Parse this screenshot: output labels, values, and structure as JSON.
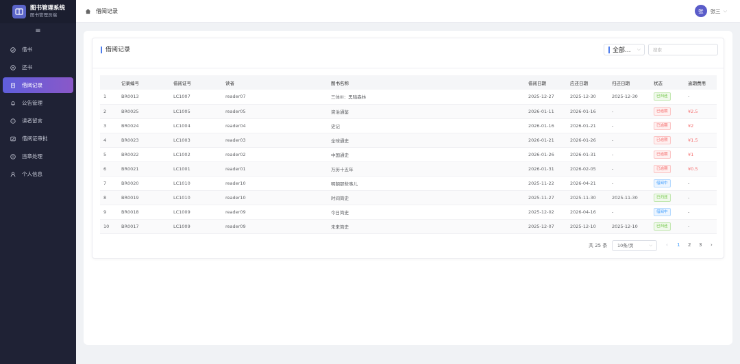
{
  "app": {
    "title": "图书管理系统",
    "subtitle": "图书管理员端"
  },
  "sidebar": {
    "items": [
      {
        "label": "借书",
        "icon": "check-circle-icon"
      },
      {
        "label": "还书",
        "icon": "return-icon"
      },
      {
        "label": "借阅记录",
        "icon": "document-icon",
        "active": true
      },
      {
        "label": "公告管理",
        "icon": "bell-icon"
      },
      {
        "label": "读者留言",
        "icon": "chat-icon"
      },
      {
        "label": "借阅证审批",
        "icon": "approval-icon"
      },
      {
        "label": "违章处理",
        "icon": "warning-icon"
      },
      {
        "label": "个人信息",
        "icon": "user-icon"
      }
    ]
  },
  "header": {
    "breadcrumb": "借阅记录"
  },
  "user": {
    "avatar_char": "张",
    "name": "张三"
  },
  "card": {
    "title": "借阅记录",
    "filter_value": "全部...",
    "search_placeholder": "搜索"
  },
  "table": {
    "columns": [
      "",
      "记录编号",
      "借阅证号",
      "读者",
      "图书名称",
      "借阅日期",
      "应还日期",
      "归还日期",
      "状态",
      "逾期费用"
    ],
    "rows": [
      {
        "idx": "1",
        "record": "BR0013",
        "card": "LC1007",
        "reader": "reader07",
        "book": "三体III：黑暗森林",
        "borrow": "2025-12-27",
        "due": "2025-12-30",
        "returned": "2025-12-30",
        "status": "已归还",
        "status_type": "returned",
        "fee": "-"
      },
      {
        "idx": "2",
        "record": "BR0025",
        "card": "LC1005",
        "reader": "reader05",
        "book": "资治通鉴",
        "borrow": "2026-01-11",
        "due": "2026-01-16",
        "returned": "-",
        "status": "已逾期",
        "status_type": "overdue",
        "fee": "¥2.5"
      },
      {
        "idx": "3",
        "record": "BR0024",
        "card": "LC1004",
        "reader": "reader04",
        "book": "史记",
        "borrow": "2026-01-16",
        "due": "2026-01-21",
        "returned": "-",
        "status": "已逾期",
        "status_type": "overdue",
        "fee": "¥2"
      },
      {
        "idx": "4",
        "record": "BR0023",
        "card": "LC1003",
        "reader": "reader03",
        "book": "全球通史",
        "borrow": "2026-01-21",
        "due": "2026-01-26",
        "returned": "-",
        "status": "已逾期",
        "status_type": "overdue",
        "fee": "¥1.5"
      },
      {
        "idx": "5",
        "record": "BR0022",
        "card": "LC1002",
        "reader": "reader02",
        "book": "中国通史",
        "borrow": "2026-01-26",
        "due": "2026-01-31",
        "returned": "-",
        "status": "已逾期",
        "status_type": "overdue",
        "fee": "¥1"
      },
      {
        "idx": "6",
        "record": "BR0021",
        "card": "LC1001",
        "reader": "reader01",
        "book": "万历十五年",
        "borrow": "2026-01-31",
        "due": "2026-02-05",
        "returned": "-",
        "status": "已逾期",
        "status_type": "overdue",
        "fee": "¥0.5"
      },
      {
        "idx": "7",
        "record": "BR0020",
        "card": "LC1010",
        "reader": "reader10",
        "book": "明朝那些事儿",
        "borrow": "2025-11-22",
        "due": "2026-04-21",
        "returned": "-",
        "status": "借阅中",
        "status_type": "borrowing",
        "fee": "-"
      },
      {
        "idx": "8",
        "record": "BR0019",
        "card": "LC1010",
        "reader": "reader10",
        "book": "时间简史",
        "borrow": "2025-11-27",
        "due": "2025-11-30",
        "returned": "2025-11-30",
        "status": "已归还",
        "status_type": "returned",
        "fee": "-"
      },
      {
        "idx": "9",
        "record": "BR0018",
        "card": "LC1009",
        "reader": "reader09",
        "book": "今日简史",
        "borrow": "2025-12-02",
        "due": "2026-04-16",
        "returned": "-",
        "status": "借阅中",
        "status_type": "borrowing",
        "fee": "-"
      },
      {
        "idx": "10",
        "record": "BR0017",
        "card": "LC1009",
        "reader": "reader09",
        "book": "未来简史",
        "borrow": "2025-12-07",
        "due": "2025-12-10",
        "returned": "2025-12-10",
        "status": "已归还",
        "status_type": "returned",
        "fee": "-"
      }
    ]
  },
  "pagination": {
    "total": "共 25 条",
    "page_size": "10条/页",
    "pages": [
      "1",
      "2",
      "3"
    ],
    "current": "1"
  },
  "colors": {
    "sidebar_bg": "#1f2235",
    "accent": "#5f5fdc",
    "active_gradient_end": "#8a58c8"
  }
}
